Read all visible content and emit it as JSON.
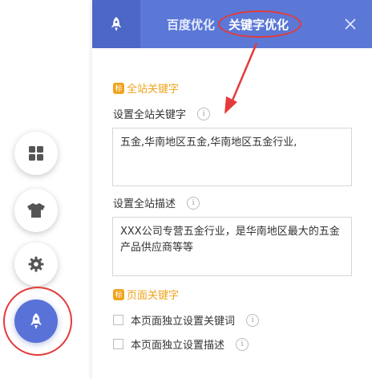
{
  "sidebar": {
    "buttons": [
      {
        "icon": "grid-icon",
        "active": false
      },
      {
        "icon": "tshirt-icon",
        "active": false
      },
      {
        "icon": "gear-icon",
        "active": false
      },
      {
        "icon": "rocket-icon",
        "active": true
      }
    ]
  },
  "header": {
    "icon": "rocket-icon",
    "tabs": [
      {
        "label": "百度优化"
      },
      {
        "label": "关键字优化"
      }
    ],
    "close_icon": "close-icon"
  },
  "site_keywords": {
    "section_title": "全站关键字",
    "section_badge": "标",
    "keyword_label": "设置全站关键字",
    "keyword_value": "五金,华南地区五金,华南地区五金行业,",
    "desc_label": "设置全站描述",
    "desc_value": "XXX公司专营五金行业，是华南地区最大的五金产品供应商等等"
  },
  "page_keywords": {
    "section_title": "页面关键字",
    "section_badge": "标",
    "options": [
      {
        "label": "本页面独立设置关键词",
        "checked": false
      },
      {
        "label": "本页面独立设置描述",
        "checked": false
      }
    ]
  },
  "info_glyph": "i",
  "colors": {
    "header_bg": "#5b78d6",
    "accent": "#5872d8",
    "section_title": "#f0a31c",
    "annotation": "#e53a3a"
  }
}
